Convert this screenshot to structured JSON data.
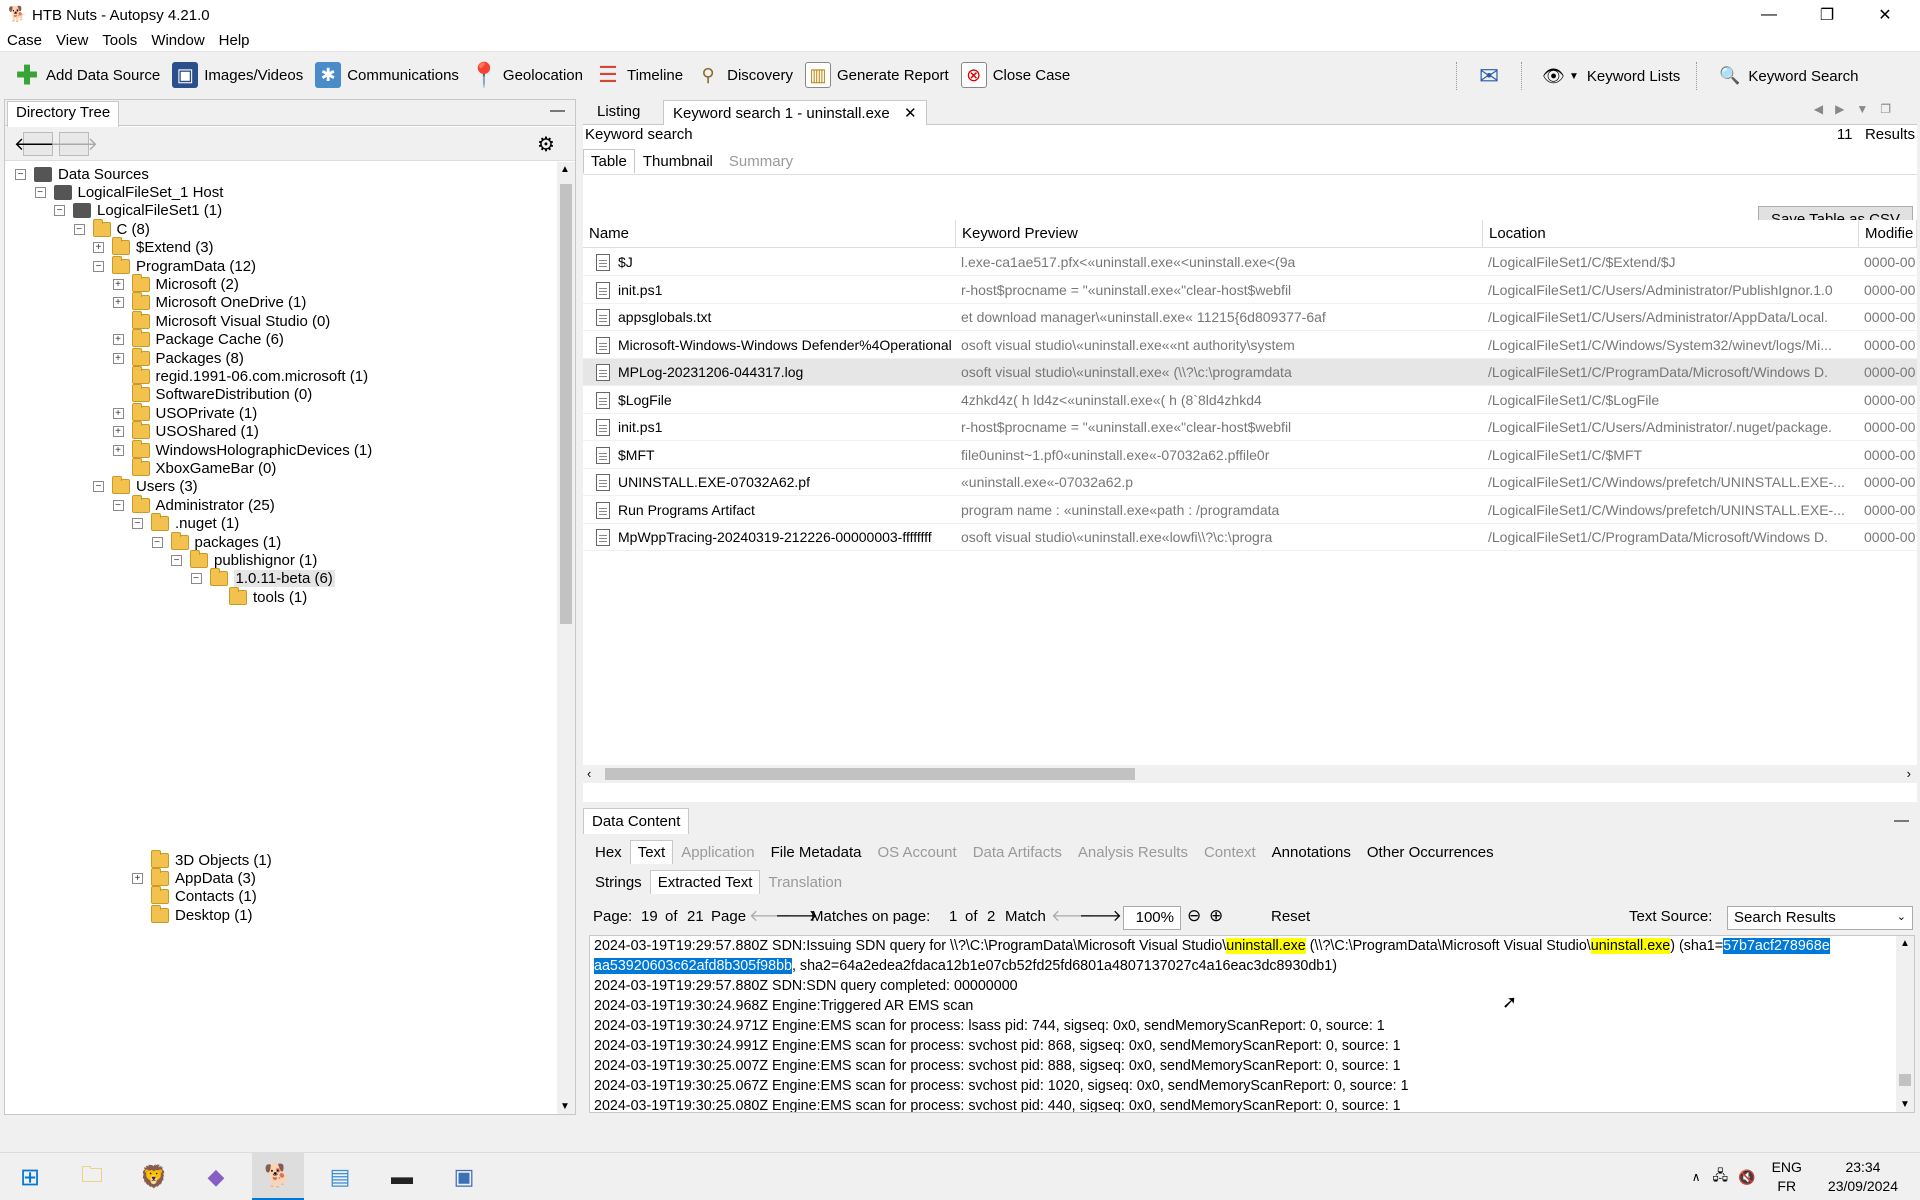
{
  "window": {
    "title": "HTB Nuts - Autopsy 4.21.0"
  },
  "menu": [
    "Case",
    "View",
    "Tools",
    "Window",
    "Help"
  ],
  "toolbar": {
    "items": [
      {
        "label": "Add Data Source",
        "icon": "plus-icon"
      },
      {
        "label": "Images/Videos",
        "icon": "images-icon"
      },
      {
        "label": "Communications",
        "icon": "communications-icon"
      },
      {
        "label": "Geolocation",
        "icon": "location-pin-icon"
      },
      {
        "label": "Timeline",
        "icon": "timeline-icon"
      },
      {
        "label": "Discovery",
        "icon": "binoculars-icon"
      },
      {
        "label": "Generate Report",
        "icon": "report-icon"
      },
      {
        "label": "Close Case",
        "icon": "close-case-icon"
      }
    ],
    "keyword_lists": "Keyword Lists",
    "keyword_search": "Keyword Search"
  },
  "left": {
    "tab": "Directory Tree",
    "tree": [
      {
        "label": "Data Sources",
        "level": 0,
        "toggle": "-",
        "icon": "drive"
      },
      {
        "label": "LogicalFileSet_1 Host",
        "level": 1,
        "toggle": "-",
        "icon": "drive"
      },
      {
        "label": "LogicalFileSet1 (1)",
        "level": 2,
        "toggle": "-",
        "icon": "drive"
      },
      {
        "label": "C (8)",
        "level": 3,
        "toggle": "-",
        "icon": "folder"
      },
      {
        "label": "$Extend (3)",
        "level": 4,
        "toggle": "+",
        "icon": "folder"
      },
      {
        "label": "ProgramData (12)",
        "level": 4,
        "toggle": "-",
        "icon": "folder"
      },
      {
        "label": "Microsoft (2)",
        "level": 5,
        "toggle": "+",
        "icon": "folder"
      },
      {
        "label": "Microsoft OneDrive (1)",
        "level": 5,
        "toggle": "+",
        "icon": "folder"
      },
      {
        "label": "Microsoft Visual Studio (0)",
        "level": 5,
        "toggle": "",
        "icon": "folder"
      },
      {
        "label": "Package Cache (6)",
        "level": 5,
        "toggle": "+",
        "icon": "folder"
      },
      {
        "label": "Packages (8)",
        "level": 5,
        "toggle": "+",
        "icon": "folder"
      },
      {
        "label": "regid.1991-06.com.microsoft (1)",
        "level": 5,
        "toggle": "",
        "icon": "folder"
      },
      {
        "label": "SoftwareDistribution (0)",
        "level": 5,
        "toggle": "",
        "icon": "folder"
      },
      {
        "label": "USOPrivate (1)",
        "level": 5,
        "toggle": "+",
        "icon": "folder"
      },
      {
        "label": "USOShared (1)",
        "level": 5,
        "toggle": "+",
        "icon": "folder"
      },
      {
        "label": "WindowsHolographicDevices (1)",
        "level": 5,
        "toggle": "+",
        "icon": "folder"
      },
      {
        "label": "XboxGameBar (0)",
        "level": 5,
        "toggle": "",
        "icon": "folder"
      },
      {
        "label": "Users (3)",
        "level": 4,
        "toggle": "-",
        "icon": "folder"
      },
      {
        "label": "Administrator (25)",
        "level": 5,
        "toggle": "-",
        "icon": "folder"
      },
      {
        "label": ".nuget (1)",
        "level": 6,
        "toggle": "-",
        "icon": "folder"
      },
      {
        "label": "packages (1)",
        "level": 7,
        "toggle": "-",
        "icon": "folder"
      },
      {
        "label": "publishignor (1)",
        "level": 8,
        "toggle": "-",
        "icon": "folder"
      },
      {
        "label": "1.0.11-beta (6)",
        "level": 9,
        "toggle": "-",
        "icon": "folder",
        "selected": true
      },
      {
        "label": "tools (1)",
        "level": 10,
        "toggle": "",
        "icon": "folder"
      }
    ],
    "tree_bottom": [
      {
        "label": "3D Objects (1)",
        "level": 6,
        "toggle": ""
      },
      {
        "label": "AppData (3)",
        "level": 6,
        "toggle": "+"
      },
      {
        "label": "Contacts (1)",
        "level": 6,
        "toggle": ""
      },
      {
        "label": "Desktop (1)",
        "level": 6,
        "toggle": ""
      }
    ]
  },
  "right": {
    "tabs": [
      "Listing",
      "Keyword search 1 - uninstall.exe"
    ],
    "header": "Keyword search",
    "results_count": "11",
    "results_label": "Results",
    "subtabs": [
      "Table",
      "Thumbnail",
      "Summary"
    ],
    "save_csv": "Save Table as CSV",
    "columns": [
      "Name",
      "Keyword Preview",
      "Location",
      "Modifie"
    ],
    "rows": [
      {
        "name": "$J",
        "preview": "l.exe-ca1ae517.pfx<«uninstall.exe«<uninstall.exe<(9a",
        "location": "/LogicalFileSet1/C/$Extend/$J",
        "modified": "0000-00"
      },
      {
        "name": "init.ps1",
        "preview": "r-host$procname = \"«uninstall.exe«\"clear-host$webfil",
        "location": "/LogicalFileSet1/C/Users/Administrator/PublishIgnor.1.0",
        "modified": "0000-00"
      },
      {
        "name": "appsglobals.txt",
        "preview": "et download manager\\«uninstall.exe«        11215{6d809377-6af",
        "location": "/LogicalFileSet1/C/Users/Administrator/AppData/Local.",
        "modified": "0000-00"
      },
      {
        "name": "Microsoft-Windows-Windows Defender%4Operational",
        "preview": "osoft visual studio\\«uninstall.exe««nt authority\\system",
        "location": "/LogicalFileSet1/C/Windows/System32/winevt/logs/Mi...",
        "modified": "0000-00"
      },
      {
        "name": "MPLog-20231206-044317.log",
        "preview": "osoft visual studio\\«uninstall.exe« (\\\\?\\c:\\programdata",
        "location": "/LogicalFileSet1/C/ProgramData/Microsoft/Windows D.",
        "modified": "0000-00",
        "selected": true
      },
      {
        "name": "$LogFile",
        "preview": "4zhkd4z( h ld4z<«uninstall.exe«( h (8`8ld4zhkd4",
        "location": "/LogicalFileSet1/C/$LogFile",
        "modified": "0000-00"
      },
      {
        "name": "init.ps1",
        "preview": "r-host$procname = \"«uninstall.exe«\"clear-host$webfil",
        "location": "/LogicalFileSet1/C/Users/Administrator/.nuget/package.",
        "modified": "0000-00"
      },
      {
        "name": "$MFT",
        "preview": "file0uninst~1.pf0«uninstall.exe«-07032a62.pffile0r",
        "location": "/LogicalFileSet1/C/$MFT",
        "modified": "0000-00"
      },
      {
        "name": "UNINSTALL.EXE-07032A62.pf",
        "preview": "«uninstall.exe«-07032a62.p",
        "location": "/LogicalFileSet1/C/Windows/prefetch/UNINSTALL.EXE-...",
        "modified": "0000-00"
      },
      {
        "name": "Run Programs Artifact",
        "preview": "program name : «uninstall.exe«path : /programdata",
        "location": "/LogicalFileSet1/C/Windows/prefetch/UNINSTALL.EXE-...",
        "modified": "0000-00"
      },
      {
        "name": "MpWppTracing-20240319-212226-00000003-ffffffff",
        "preview": "osoft visual studio\\«uninstall.exe«lowfi\\\\?\\c:\\progra",
        "location": "/LogicalFileSet1/C/ProgramData/Microsoft/Windows D.",
        "modified": "0000-00"
      }
    ]
  },
  "data_content": {
    "title": "Data Content",
    "tabs": [
      {
        "label": "Hex",
        "disabled": false
      },
      {
        "label": "Text",
        "disabled": false,
        "active": true
      },
      {
        "label": "Application",
        "disabled": true
      },
      {
        "label": "File Metadata",
        "disabled": false
      },
      {
        "label": "OS Account",
        "disabled": true
      },
      {
        "label": "Data Artifacts",
        "disabled": true
      },
      {
        "label": "Analysis Results",
        "disabled": true
      },
      {
        "label": "Context",
        "disabled": true
      },
      {
        "label": "Annotations",
        "disabled": false
      },
      {
        "label": "Other Occurrences",
        "disabled": false
      }
    ],
    "subtabs": [
      {
        "label": "Strings",
        "disabled": false
      },
      {
        "label": "Extracted Text",
        "disabled": false,
        "active": true
      },
      {
        "label": "Translation",
        "disabled": true
      }
    ],
    "page_label": "Page:",
    "page_current": "19",
    "page_of": "of",
    "page_total": "21",
    "page_word": "Page",
    "matches_label": "Matches on page:",
    "match_current": "1",
    "match_of": "of",
    "match_total": "2",
    "match_word": "Match",
    "zoom": "100%",
    "reset": "Reset",
    "text_source_label": "Text Source:",
    "text_source_value": "Search Results",
    "line1_a": "2024-03-19T19:29:57.880Z SDN:Issuing SDN query for \\\\?\\C:\\ProgramData\\Microsoft Visual Studio\\",
    "line1_hl1": "uninstall.exe",
    "line1_b": " (\\\\?\\C:\\ProgramData\\Microsoft Visual Studio\\",
    "line1_hl2": "uninstall.exe",
    "line1_c": ") (sha1=",
    "line1_sel": "57b7acf278968e",
    "line2_sel": "aa53920603c62afd8b305f98bb",
    "line2_rest": ", sha2=64a2edea2fdaca12b1e07cb52fd25fd6801a4807137027c4a16eac3dc8930db1)",
    "lines": [
      "2024-03-19T19:29:57.880Z SDN:SDN query completed: 00000000",
      "2024-03-19T19:30:24.968Z Engine:Triggered AR EMS scan",
      "2024-03-19T19:30:24.971Z Engine:EMS scan for process: lsass pid: 744, sigseq: 0x0, sendMemoryScanReport: 0, source: 1",
      "2024-03-19T19:30:24.991Z Engine:EMS scan for process: svchost pid: 868, sigseq: 0x0, sendMemoryScanReport: 0, source: 1",
      "2024-03-19T19:30:25.007Z Engine:EMS scan for process: svchost pid: 888, sigseq: 0x0, sendMemoryScanReport: 0, source: 1",
      "2024-03-19T19:30:25.067Z Engine:EMS scan for process: svchost pid: 1020, sigseq: 0x0, sendMemoryScanReport: 0, source: 1",
      "2024-03-19T19:30:25.080Z Engine:EMS scan for process: svchost pid: 440, sigseq: 0x0, sendMemoryScanReport: 0, source: 1"
    ]
  },
  "taskbar": {
    "apps": [
      "start-icon",
      "file-explorer-icon",
      "brave-browser-icon",
      "visual-studio-icon",
      "autopsy-icon",
      "notepad-icon",
      "terminal-icon",
      "screenshot-tool-icon"
    ],
    "lang1": "ENG",
    "lang2": "FR",
    "time": "23:34",
    "date": "23/09/2024"
  }
}
